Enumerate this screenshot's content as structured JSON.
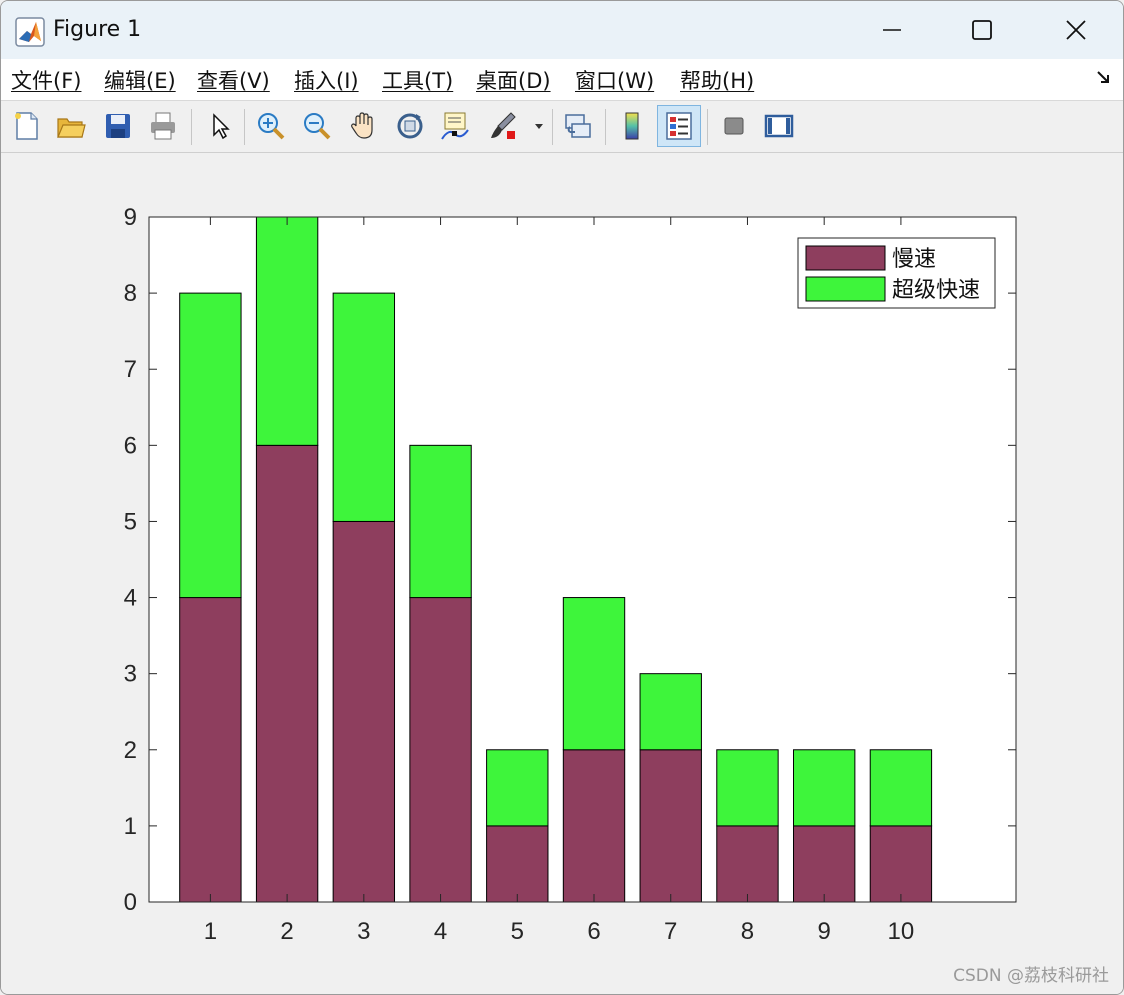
{
  "window": {
    "title": "Figure 1",
    "controls": [
      "minimize",
      "maximize",
      "close"
    ]
  },
  "menu": [
    "文件(F)",
    "编辑(E)",
    "查看(V)",
    "插入(I)",
    "工具(T)",
    "桌面(D)",
    "窗口(W)",
    "帮助(H)"
  ],
  "toolbar": {
    "icons": [
      "new-figure-icon",
      "open-icon",
      "save-icon",
      "print-icon",
      "select-arrow-icon",
      "zoom-in-icon",
      "zoom-out-icon",
      "pan-hand-icon",
      "rotate-3d-icon",
      "data-cursor-icon",
      "brush-icon",
      "link-plot-icon",
      "colorbar-icon",
      "legend-icon",
      "hide-plot-tools-icon",
      "show-plot-tools-icon"
    ],
    "active": "legend-icon"
  },
  "chart_data": {
    "type": "bar",
    "stacked": true,
    "categories": [
      "1",
      "2",
      "3",
      "4",
      "5",
      "6",
      "7",
      "8",
      "9",
      "10"
    ],
    "series": [
      {
        "name": "慢速",
        "color": "#8e3e5e",
        "values": [
          4,
          6,
          5,
          4,
          1,
          2,
          2,
          1,
          1,
          1
        ]
      },
      {
        "name": "超级快速",
        "color": "#3ef53b",
        "values": [
          4,
          3,
          3,
          2,
          1,
          2,
          1,
          1,
          1,
          1
        ]
      }
    ],
    "yticks": [
      "0",
      "1",
      "2",
      "3",
      "4",
      "5",
      "6",
      "7",
      "8",
      "9"
    ],
    "ylim": [
      0,
      9
    ],
    "xlim": [
      0.2,
      11.5
    ],
    "legend_position": "top-right",
    "grid": false
  },
  "watermark": "CSDN @荔枝科研社"
}
